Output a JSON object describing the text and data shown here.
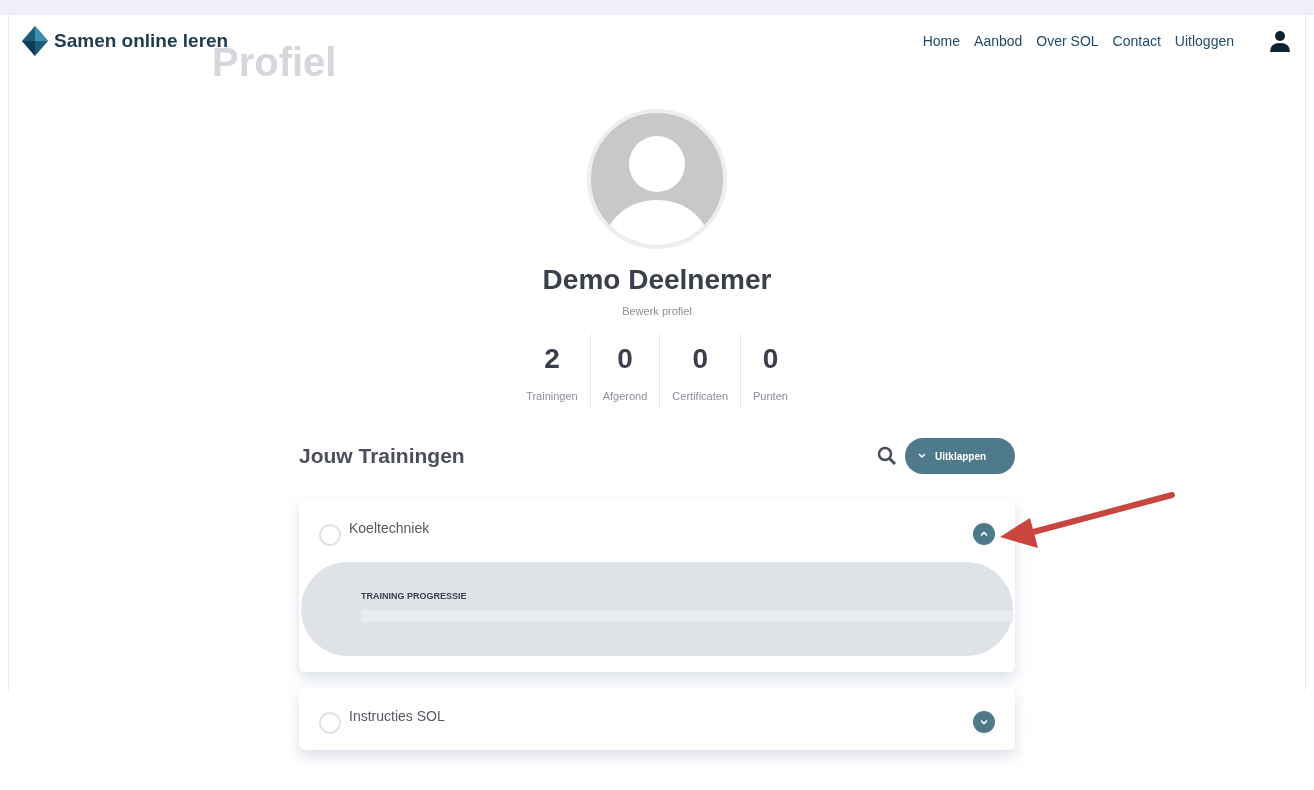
{
  "brand": {
    "name": "Samen online leren"
  },
  "page_title": "Profiel",
  "nav": [
    {
      "label": "Home"
    },
    {
      "label": "Aanbod"
    },
    {
      "label": "Over SOL"
    },
    {
      "label": "Contact"
    },
    {
      "label": "Uitloggen"
    }
  ],
  "profile": {
    "name": "Demo Deelnemer",
    "edit_link": "Bewerk profiel"
  },
  "stats": [
    {
      "value": "2",
      "label": "Trainingen"
    },
    {
      "value": "0",
      "label": "Afgerond"
    },
    {
      "value": "0",
      "label": "Certificaten"
    },
    {
      "value": "0",
      "label": "Punten"
    }
  ],
  "trainings_section": {
    "title": "Jouw Trainingen",
    "expand_button": "Uitklappen"
  },
  "trainings": [
    {
      "title": "Koeltechniek",
      "completed": false,
      "expanded": true,
      "progress_label": "TRAINING PROGRESSIE",
      "level": 0
    },
    {
      "title": "Instructies SOL",
      "completed": false,
      "expanded": false
    }
  ]
}
